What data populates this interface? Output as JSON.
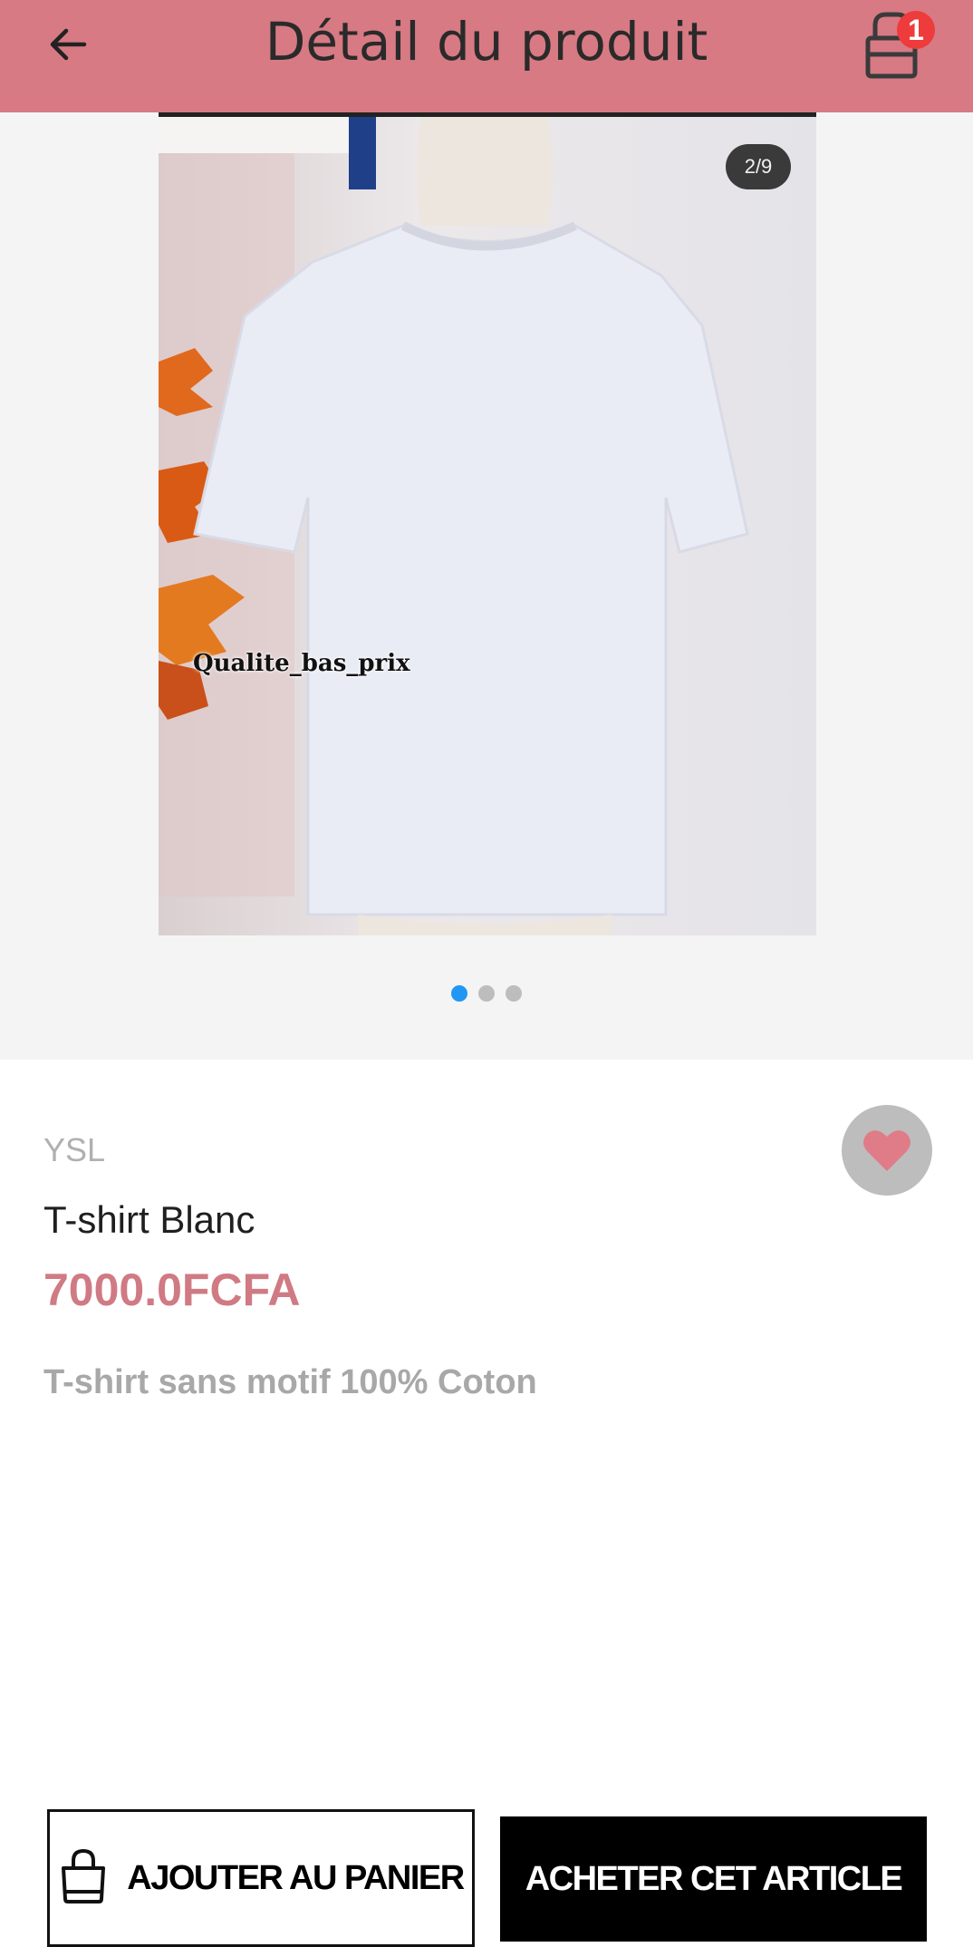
{
  "header": {
    "title": "Détail du produit",
    "cart_count": "1",
    "color": "#d77a84"
  },
  "gallery": {
    "counter": "2/9",
    "watermark": "Qualite_bas_prix",
    "dots_total": 3,
    "dots_active_index": 0
  },
  "product": {
    "brand": "YSL",
    "name": "T-shirt Blanc",
    "price": "7000.0FCFA",
    "description": "T-shirt sans motif 100% Coton",
    "favorite": true
  },
  "actions": {
    "add_to_cart_label": "AJOUTER AU PANIER",
    "buy_label": "ACHETER CET ARTICLE"
  },
  "icons": {
    "back": "arrow-left-icon",
    "cart": "shopping-bag-icon",
    "favorite": "heart-icon",
    "add_to_cart": "shopping-bag-icon"
  },
  "colors": {
    "accent": "#d77a84",
    "price": "#d07a84",
    "badge": "#ee3b3b",
    "active_dot": "#2196f3"
  }
}
